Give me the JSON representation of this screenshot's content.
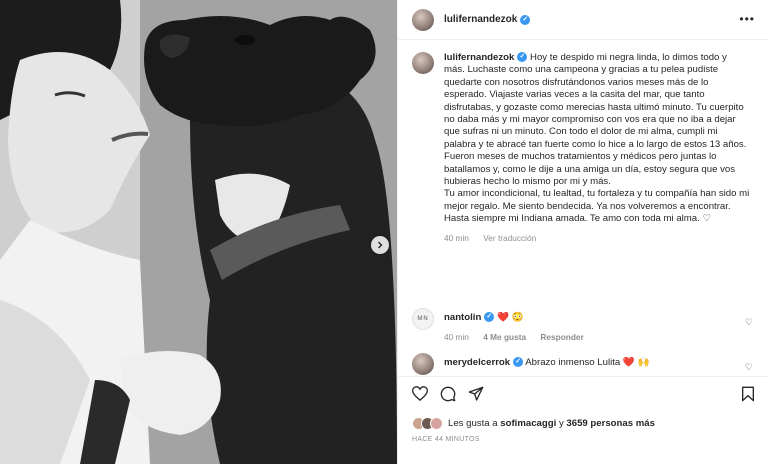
{
  "post": {
    "username": "lulifernandezok",
    "caption": "Hoy te despido mi negra linda, lo dimos todo y más. Luchaste como una campeona y gracias a tu pelea pudiste quedarte con nosotros disfrutándonos varios meses más de lo esperado. Viajaste varias veces a la casita del mar, que tanto disfrutabas, y gozaste como merecias hasta ultimó minuto. Tu cuerpito no daba más y mi mayor compromiso con vos era que no iba a dejar que sufras ni un minuto. Con todo el dolor de mi alma, cumpli mi palabra y te abracé tan fuerte como lo hice a lo largo de estos 13 años.\nFueron meses de muchos tratamientos y médicos pero juntas lo batallamos y, como le dije a una amiga un día, estoy segura que vos hubieras hecho lo mismo por mi y más.\nTu amor incondicional, tu lealtad, tu fortaleza y tu compañía han sido mi mejor regalo. Me siento bendecida. Ya nos volveremos a encontrar. Hasta siempre mi Indiana amada. Te amo con toda mi alma. ♡",
    "caption_time": "40 min",
    "see_translation": "Ver traducción"
  },
  "comments": [
    {
      "username": "nantolin",
      "text": "❤️ 😳",
      "time": "40 min",
      "likes": "4 Me gusta",
      "reply": "Responder"
    },
    {
      "username": "merydelcerrok",
      "text": "Abrazo inmenso Lulita ❤️ 🙌"
    }
  ],
  "likes": {
    "prefix": "Les gusta a",
    "user": "sofimacaggi",
    "middle": "y",
    "count": "3659 personas más"
  },
  "timestamp": "HACE 44 MINUTOS",
  "icons": [
    "more-icon",
    "heart-icon",
    "comment-icon",
    "share-icon",
    "bookmark-icon",
    "chevron-right-icon",
    "verified-icon"
  ],
  "colors": {
    "verified": "#3897f0",
    "meta": "#8e8e8e",
    "heart": "#ed4956"
  }
}
